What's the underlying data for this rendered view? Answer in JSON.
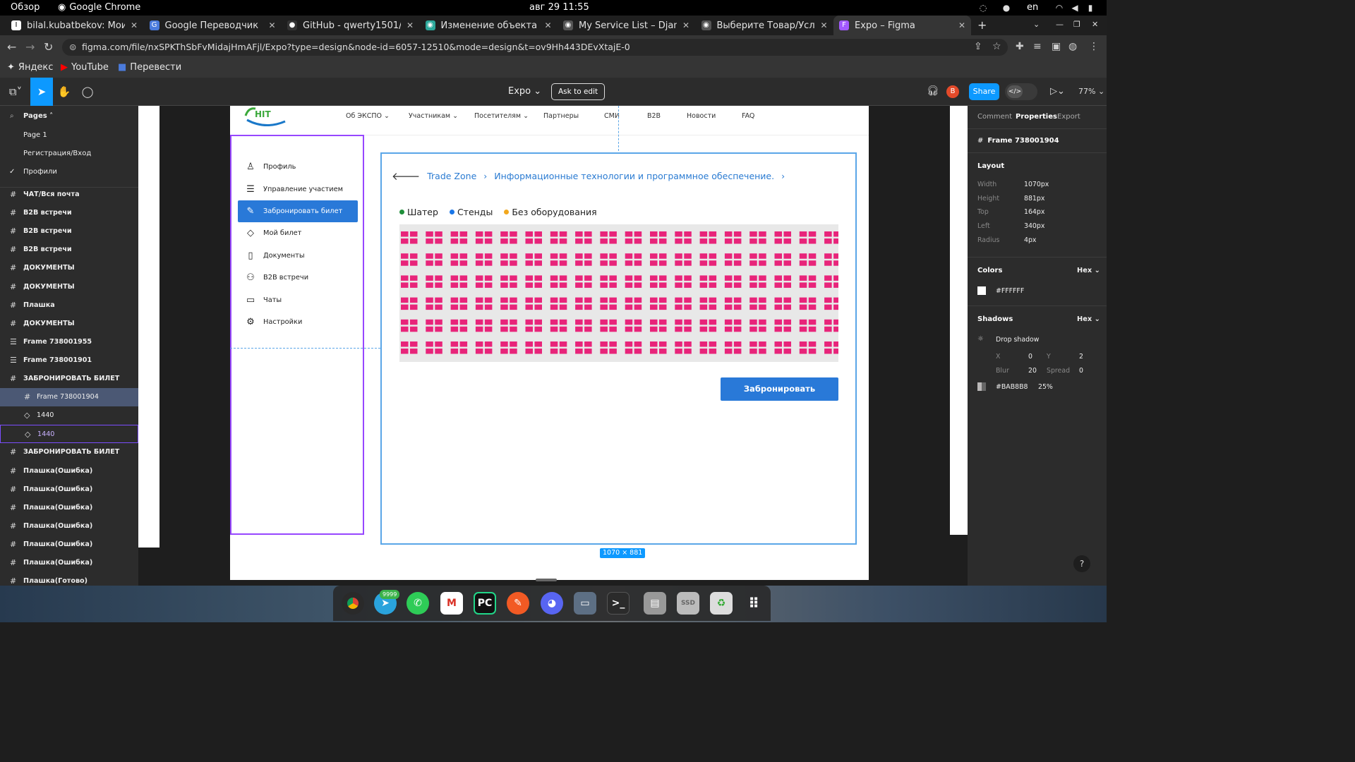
{
  "os": {
    "overview": "Обзор",
    "app": "Google Chrome",
    "clock": "авг 29  11:55",
    "lang": "en"
  },
  "tabs": [
    {
      "title": "bilal.kubatbekov: Мои пл",
      "fav": "I",
      "color": "#fff"
    },
    {
      "title": "Google Переводчик",
      "fav": "G",
      "color": "#4b7bdc"
    },
    {
      "title": "GitHub - qwerty1501/card",
      "fav": "●",
      "color": "#333"
    },
    {
      "title": "Изменение объекта в DR",
      "fav": "◉",
      "color": "#2ca89b"
    },
    {
      "title": "My Service List – Django R",
      "fav": "◉",
      "color": "#555"
    },
    {
      "title": "Выберите Товар/Услуга /",
      "fav": "◉",
      "color": "#555"
    },
    {
      "title": "Expo – Figma",
      "fav": "F",
      "color": "#a259ff"
    }
  ],
  "url": "figma.com/file/nxSPKThSbFvMidajHmAFjl/Expo?type=design&node-id=6057-12510&mode=design&t=ov9Hh443DEvXtajE-0",
  "bookmarks": [
    "Яндекс",
    "YouTube",
    "Перевести"
  ],
  "figma": {
    "file": "Expo",
    "ask": "Ask to edit",
    "share": "Share",
    "avatar": "B",
    "zoom": "77%"
  },
  "pages": {
    "header": "Pages",
    "items": [
      "Page 1",
      "Регистрация/Вход",
      "Профили"
    ]
  },
  "layers": [
    "ЧАТ/Вся почта",
    "B2B встречи",
    "B2B встречи",
    "B2B встречи",
    "ДОКУМЕНТЫ",
    "ДОКУМЕНТЫ",
    "Плашка",
    "ДОКУМЕНТЫ",
    "Frame 738001955",
    "Frame 738001901",
    "ЗАБРОНИРОВАТЬ БИЛЕТ",
    "Frame 738001904",
    "1440",
    "1440",
    "ЗАБРОНИРОВАТЬ БИЛЕТ",
    "Плашка(Ошибка)",
    "Плашка(Ошибка)",
    "Плашка(Ошибка)",
    "Плашка(Ошибка)",
    "Плашка(Ошибка)",
    "Плашка(Ошибка)",
    "Плашка(Готово)"
  ],
  "site": {
    "logo": "HIT",
    "nav": [
      "Об ЭКСПО ⌄",
      "Участникам ⌄",
      "Посетителям ⌄",
      "Партнеры",
      "СМИ",
      "B2B",
      "Новости",
      "FAQ"
    ],
    "menu": [
      {
        "label": "Профиль",
        "icon": "user-icon"
      },
      {
        "label": "Управление участием",
        "icon": "stack-icon"
      },
      {
        "label": "Забронировать билет",
        "icon": "edit-icon"
      },
      {
        "label": "Мой билет",
        "icon": "ticket-icon"
      },
      {
        "label": "Документы",
        "icon": "document-icon"
      },
      {
        "label": "B2B встречи",
        "icon": "users-icon"
      },
      {
        "label": "Чаты",
        "icon": "chat-icon"
      },
      {
        "label": "Настройки",
        "icon": "gear-icon"
      }
    ],
    "breadcrumb": [
      "Trade Zone",
      "Информационные технологии и программное обеспечение."
    ],
    "legend": [
      {
        "label": "Шатер",
        "color": "#1f8f3a"
      },
      {
        "label": "Стенды",
        "color": "#1976e8"
      },
      {
        "label": "Без оборудования",
        "color": "#f2a81d"
      }
    ],
    "seat_color": "#e8247a",
    "book": "Забронировать",
    "size": "1070 × 881"
  },
  "props": {
    "tabs": [
      "Comment",
      "Properties",
      "Export"
    ],
    "frame": "Frame 738001904",
    "layout": {
      "title": "Layout",
      "rows": [
        [
          "Width",
          "1070px"
        ],
        [
          "Height",
          "881px"
        ],
        [
          "Top",
          "164px"
        ],
        [
          "Left",
          "340px"
        ],
        [
          "Radius",
          "4px"
        ]
      ]
    },
    "colors": {
      "title": "Colors",
      "mode": "Hex",
      "fill": "#FFFFFF"
    },
    "shadows": {
      "title": "Shadows",
      "mode": "Hex",
      "type": "Drop shadow",
      "x": "0",
      "y": "2",
      "blur": "20",
      "spread": "0",
      "color": "#BAB8B8",
      "opacity": "25%"
    }
  },
  "dock_badge": "9999"
}
